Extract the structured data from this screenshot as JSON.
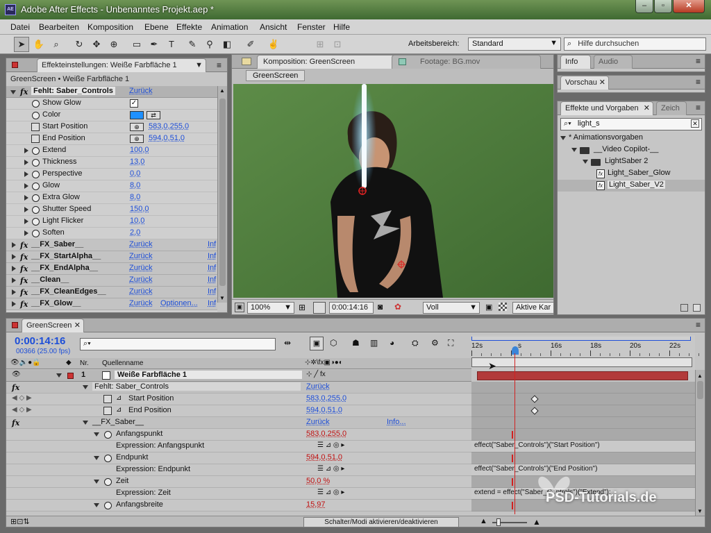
{
  "window": {
    "title": "Adobe After Effects - Unbenanntes Projekt.aep *",
    "app_icon": "AE"
  },
  "menu": [
    "Datei",
    "Bearbeiten",
    "Komposition",
    "Ebene",
    "Effekte",
    "Animation",
    "Ansicht",
    "Fenster",
    "Hilfe"
  ],
  "toolbar": {
    "workspace_label": "Arbeitsbereich:",
    "workspace_value": "Standard",
    "help_placeholder": "Hilfe durchsuchen"
  },
  "effects_panel": {
    "tab": "Effekteinstellungen: Weiße Farbfläche 1",
    "breadcrumb": "GreenScreen • Weiße Farbfläche 1",
    "effect_header": {
      "name": "Fehlt: Saber_Controls",
      "reset": "Zurück"
    },
    "params": [
      {
        "label": "Show Glow",
        "value": "✓",
        "kind": "check"
      },
      {
        "label": "Color",
        "value": "",
        "kind": "color"
      },
      {
        "label": "Start Position",
        "value": "583,0,255,0",
        "kind": "point"
      },
      {
        "label": "End Position",
        "value": "594,0,51,0",
        "kind": "point"
      },
      {
        "label": "Extend",
        "value": "100,0",
        "kind": "num"
      },
      {
        "label": "Thickness",
        "value": "13,0",
        "kind": "num"
      },
      {
        "label": "Perspective",
        "value": "0,0",
        "kind": "num"
      },
      {
        "label": "Glow",
        "value": "8,0",
        "kind": "num"
      },
      {
        "label": "Extra Glow",
        "value": "8,0",
        "kind": "num"
      },
      {
        "label": "Shutter Speed",
        "value": "150,0",
        "kind": "num"
      },
      {
        "label": "Light Flicker",
        "value": "10,0",
        "kind": "num"
      },
      {
        "label": "Soften",
        "value": "2,0",
        "kind": "num"
      }
    ],
    "fx_list": [
      {
        "name": "__FX_Saber__",
        "reset": "Zurück",
        "extra": "Inf"
      },
      {
        "name": "__FX_StartAlpha__",
        "reset": "Zurück",
        "extra": "Inf"
      },
      {
        "name": "__FX_EndAlpha__",
        "reset": "Zurück",
        "extra": "Inf"
      },
      {
        "name": "__Clean__",
        "reset": "Zurück",
        "extra": "Inf"
      },
      {
        "name": "__FX_CleanEdges__",
        "reset": "Zurück",
        "extra": "Inf"
      },
      {
        "name": "__FX_Glow__",
        "reset": "Zurück",
        "options": "Optionen...",
        "extra": "Inf"
      }
    ]
  },
  "comp_panel": {
    "tab1": "Komposition: GreenScreen",
    "tab2": "Footage: BG.mov",
    "sub_tab": "GreenScreen",
    "zoom": "100%",
    "timecode": "0:00:14:16",
    "resolution": "Voll",
    "camera": "Aktive Kar"
  },
  "info_panel": {
    "tab1": "Info",
    "tab2": "Audio",
    "preview": "Vorschau"
  },
  "effects_presets": {
    "tab1": "Effekte und Vorgaben",
    "tab2": "Zeich",
    "search": "light_s",
    "tree": [
      {
        "label": "* Animationsvorgaben",
        "kind": "root"
      },
      {
        "label": "__Video Copilot-__",
        "kind": "folder"
      },
      {
        "label": "LightSaber 2",
        "kind": "folder"
      },
      {
        "label": "Light_Saber_Glow",
        "kind": "preset"
      },
      {
        "label": "Light_Saber_V2",
        "kind": "preset"
      }
    ]
  },
  "timeline": {
    "tab": "GreenScreen",
    "timecode": "0:00:14:16",
    "frames": "00366 (25.00 fps)",
    "search_placeholder": "",
    "col_nr": "Nr.",
    "col_source": "Quellenname",
    "ruler": [
      "12s",
      "s",
      "16s",
      "18s",
      "20s",
      "22s"
    ],
    "layer": {
      "num": "1",
      "name": "Weiße Farbfläche 1"
    },
    "rows": [
      {
        "label": "Fehlt: Saber_Controls",
        "value": "Zurück",
        "kind": "effect"
      },
      {
        "label": "Start Position",
        "value": "583,0,255,0",
        "kind": "prop"
      },
      {
        "label": "End Position",
        "value": "594,0,51,0",
        "kind": "prop"
      },
      {
        "label": "__FX_Saber__",
        "value": "Zurück",
        "info": "Info...",
        "kind": "effect"
      },
      {
        "label": "Anfangspunkt",
        "value": "583,0,255,0",
        "kind": "expr-prop"
      },
      {
        "label": "Expression: Anfangspunkt",
        "expr": "effect(\"Saber_Controls\")(\"Start Position\")",
        "kind": "expr"
      },
      {
        "label": "Endpunkt",
        "value": "594,0,51,0",
        "kind": "expr-prop"
      },
      {
        "label": "Expression: Endpunkt",
        "expr": "effect(\"Saber_Controls\")(\"End Position\")",
        "kind": "expr"
      },
      {
        "label": "Zeit",
        "value": "50,0 %",
        "kind": "expr-prop"
      },
      {
        "label": "Expression: Zeit",
        "expr": "extend = effect(\"Saber_Controls\")(\"Extend\");",
        "kind": "expr"
      },
      {
        "label": "Anfangsbreite",
        "value": "15,97",
        "kind": "expr-prop"
      }
    ],
    "bottom_toggle": "Schalter/Modi aktivieren/deaktivieren"
  },
  "watermark": "PSD-Tutorials.de",
  "colors": {
    "accent": "#1d4ed8",
    "layer_bar": "#b23a3a",
    "cti": "#d22020",
    "saber": "#cfefff"
  }
}
